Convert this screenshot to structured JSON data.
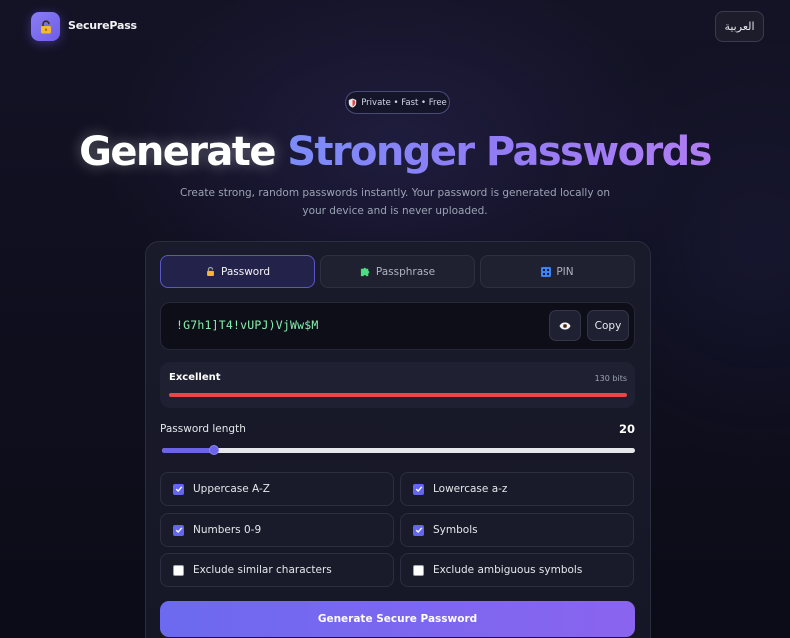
{
  "header": {
    "brand": "SecurePass",
    "language_button": "العربية"
  },
  "hero": {
    "badge": "Private • Fast • Free",
    "title_plain": "Generate",
    "title_gradient": "Stronger Passwords",
    "subtitle": "Create strong, random passwords instantly. Your password is generated locally on your device and is never uploaded."
  },
  "tabs": [
    {
      "label": "Password",
      "icon": "lock-icon",
      "active": true
    },
    {
      "label": "Passphrase",
      "icon": "puzzle-icon",
      "active": false
    },
    {
      "label": "PIN",
      "icon": "keypad-icon",
      "active": false
    }
  ],
  "output": {
    "password": "!G7h1]T4!vUPJ)VjWw$M",
    "copy_label": "Copy",
    "reveal_icon": "eye-icon"
  },
  "strength": {
    "label": "Excellent",
    "bits": "130 bits",
    "level": 1.0,
    "color": "#ef4444"
  },
  "length": {
    "label": "Password length",
    "value": "20",
    "slider_fraction": 0.11
  },
  "options": [
    {
      "label": "Uppercase A-Z",
      "checked": true
    },
    {
      "label": "Lowercase a-z",
      "checked": true
    },
    {
      "label": "Numbers 0-9",
      "checked": true
    },
    {
      "label": "Symbols",
      "checked": true
    },
    {
      "label": "Exclude similar characters",
      "checked": false
    },
    {
      "label": "Exclude ambiguous symbols",
      "checked": false
    }
  ],
  "generate_button": "Generate Secure Password",
  "colors": {
    "accent": "#6366f1",
    "password_text": "#86efac"
  }
}
